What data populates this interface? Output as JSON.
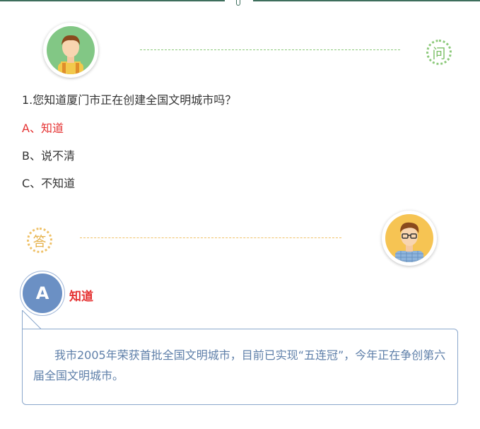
{
  "question": {
    "text": "1.您知道厦门市正在创建全国文明城市吗？",
    "options": [
      {
        "label": "A、知道",
        "selected": true
      },
      {
        "label": "B、说不清",
        "selected": false
      },
      {
        "label": "C、不知道",
        "selected": false
      }
    ],
    "tag": "问"
  },
  "answer": {
    "tag": "答",
    "badge": "A",
    "title": "知道",
    "body": "我市2005年荣获首批全国文明城市，目前已实现“五连冠”，今年正在争创第六届全国文明城市。"
  },
  "colors": {
    "top_line": "#3d6e5c",
    "question_accent": "#8cc97a",
    "answer_accent": "#efc168",
    "selected": "#e53333",
    "answer_blue": "#6b90c4",
    "answer_text": "#5e7fa9"
  },
  "icons": {
    "question_avatar": "worker-avatar-icon",
    "answer_avatar": "glasses-man-avatar-icon"
  }
}
